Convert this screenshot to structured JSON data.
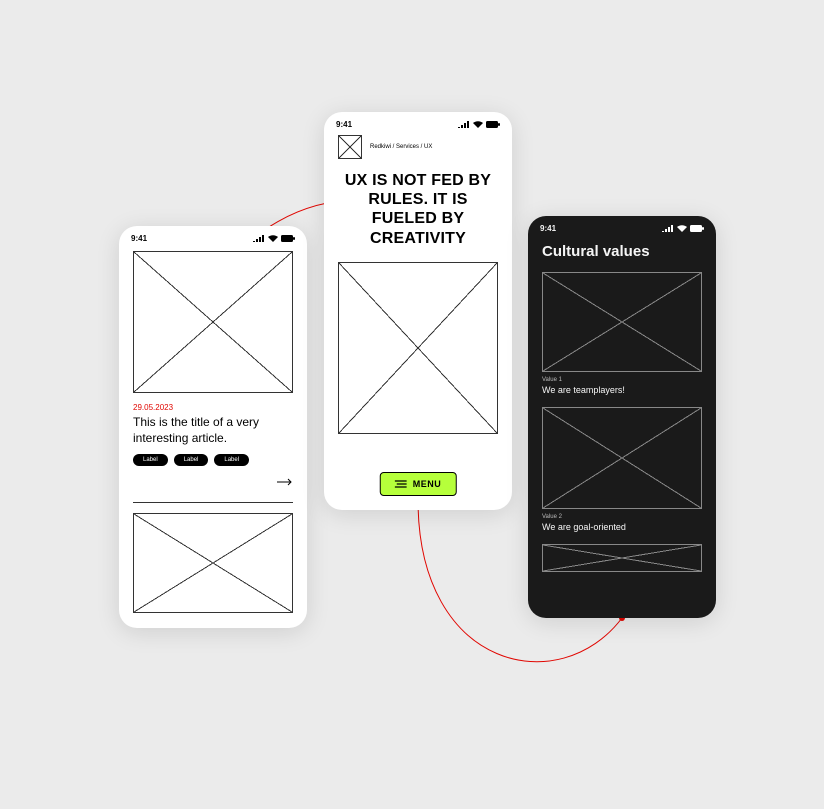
{
  "statusbar": {
    "time": "9:41"
  },
  "phone1": {
    "date": "29.05.2023",
    "title": "This is the title of a very interesting article.",
    "chips": [
      "Label",
      "Label",
      "Label"
    ]
  },
  "phone2": {
    "breadcrumb": "Redkiwi / Services / UX",
    "hero": "UX IS NOT FED BY RULES. IT IS FUELED BY CREATIVITY",
    "menu_label": "MENU"
  },
  "phone3": {
    "section_title": "Cultural values",
    "v1_caption": "Value 1",
    "v1_text": "We are teamplayers!",
    "v2_caption": "Value 2",
    "v2_text": "We are goal-oriented"
  },
  "colors": {
    "accent": "#e10600",
    "menu_bg": "#b6ff3b"
  }
}
